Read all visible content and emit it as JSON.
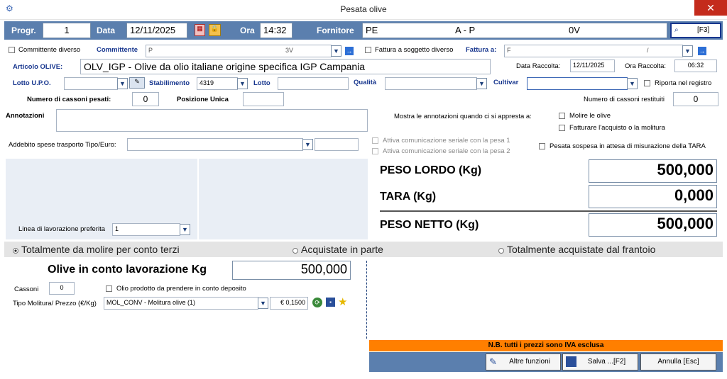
{
  "window": {
    "title": "Pesata olive",
    "close": "✕"
  },
  "header": {
    "progr_label": "Progr.",
    "progr_value": "1",
    "data_label": "Data",
    "data_value": "12/11/2025",
    "ora_label": "Ora",
    "ora_value": "14:32",
    "fornitore_label": "Fornitore",
    "fornitore_code": "PE",
    "fornitore_mid": "A - P",
    "fornitore_end": "0V",
    "search_label": "[F3]"
  },
  "row1": {
    "committente_diverso": "Committente diverso",
    "committente_label": "Committente",
    "committente_value": "P",
    "committente_mid": "3V",
    "fattura_soggetto": "Fattura a soggetto diverso",
    "fattura_label": "Fattura a:",
    "fattura_value": "F",
    "fattura_mid": "/"
  },
  "articolo": {
    "label": "Articolo OLIVE:",
    "value": "OLV_IGP -  Olive da olio italiane origine specifica IGP Campania",
    "data_raccolta_label": "Data Raccolta:",
    "data_raccolta_value": "12/11/2025",
    "ora_raccolta_label": "Ora Raccolta:",
    "ora_raccolta_value": "06:32"
  },
  "lotto": {
    "lotto_upo_label": "Lotto U.P.O.",
    "stabilimento_label": "Stabilimento",
    "stabilimento_value": "4319",
    "lotto_label": "Lotto",
    "qualita_label": "Qualità",
    "cultivar_label": "Cultivar",
    "riporta_label": "Riporta nel registro"
  },
  "cassoni": {
    "pesati_label": "Numero di cassoni pesati:",
    "pesati_value": "0",
    "posizione_label": "Posizione Unica",
    "restituiti_label": "Numero di cassoni restituiti",
    "restituiti_value": "0"
  },
  "annotazioni": {
    "label": "Annotazioni",
    "mostra_label": "Mostra le annotazioni quando ci si appresta a:",
    "molire": "Molire le olive",
    "fatturare": "Fatturare l'acquisto o la molitura"
  },
  "addebito": {
    "label": "Addebito spese trasporto Tipo/Euro:",
    "seriale1": "Attiva comunicazione seriale con la pesa 1",
    "seriale2": "Attiva comunicazione seriale con la pesa 2",
    "sospesa": "Pesata sospesa in attesa di misurazione della TARA"
  },
  "pesi": {
    "lordo_label": "PESO LORDO (Kg)",
    "lordo_value": "500,000",
    "tara_label": "TARA (Kg)",
    "tara_value": "0,000",
    "netto_label": "PESO NETTO (Kg)",
    "netto_value": "500,000"
  },
  "linea": {
    "label": "Linea di lavorazione preferita",
    "value": "1"
  },
  "radio": {
    "opt1": "Totalmente da molire per conto terzi",
    "opt2": "Acquistate in parte",
    "opt3": "Totalmente acquistate dal frantoio"
  },
  "lavorazione": {
    "label": "Olive in conto lavorazione Kg",
    "value": "500,000",
    "cassoni_label": "Cassoni",
    "cassoni_value": "0",
    "olio_deposito": "Olio prodotto da prendere in conto deposito",
    "molitura_label": "Tipo Molitura/ Prezzo (€/Kg)",
    "molitura_value": "MOL_CONV -  Molitura olive (1)",
    "prezzo_value": "€ 0,1500"
  },
  "footer": {
    "nb": "N.B. tutti i prezzi sono IVA esclusa",
    "altre": "Altre funzioni",
    "salva": "Salva ...[F2]",
    "annulla": "Annulla [Esc]"
  },
  "colors": {
    "accent": "#5b7fae",
    "label_blue": "#17368e",
    "orange": "#ff7f00"
  }
}
